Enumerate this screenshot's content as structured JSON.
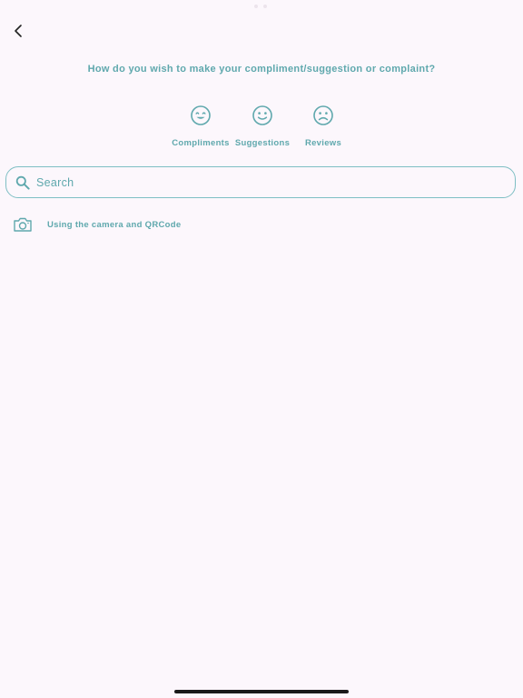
{
  "header": {
    "question": "How do you wish to make your compliment/suggestion or complaint?"
  },
  "choices": [
    {
      "label": "Compliments",
      "icon": "happy-face-icon"
    },
    {
      "label": "Suggestions",
      "icon": "smile-face-icon"
    },
    {
      "label": "Reviews",
      "icon": "sad-face-icon"
    }
  ],
  "search": {
    "placeholder": "Search",
    "value": ""
  },
  "camera": {
    "label": "Using the camera and QRCode",
    "icon": "camera-icon"
  },
  "colors": {
    "accent": "#5fa8ad",
    "background": "#fcf7fc",
    "border": "#7fbfc4"
  }
}
